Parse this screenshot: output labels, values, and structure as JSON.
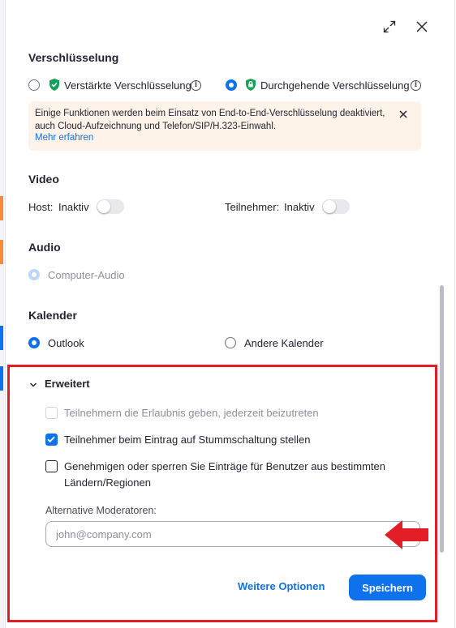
{
  "colors": {
    "accent": "#0e72ed",
    "warning_bg": "#fdf3e9",
    "highlight": "#e31d26",
    "shield_green": "#13a05a"
  },
  "header": {
    "expand_icon": "expand-icon",
    "close_icon": "close-icon"
  },
  "encryption": {
    "title": "Verschlüsselung",
    "enhanced_label": "Verstärkte Verschlüsselung",
    "e2e_label": "Durchgehende Verschlüsselung",
    "selected": "e2e",
    "banner_text": "Einige Funktionen werden beim Einsatz von End-to-End-Verschlüsselung deaktiviert, auch Cloud-Aufzeichnung und Telefon/SIP/H.323-Einwahl.",
    "banner_link": "Mehr erfahren"
  },
  "video": {
    "title": "Video",
    "host_label": "Host:",
    "host_state": "Inaktiv",
    "host_on": false,
    "participant_label": "Teilnehmer:",
    "participant_state": "Inaktiv",
    "participant_on": false
  },
  "audio": {
    "title": "Audio",
    "option": "Computer-Audio"
  },
  "calendar": {
    "title": "Kalender",
    "outlook": "Outlook",
    "other": "Andere Kalender",
    "selected": "outlook"
  },
  "advanced": {
    "title": "Erweitert",
    "join_anytime": "Teilnehmern die Erlaubnis geben, jederzeit beizutreten",
    "join_anytime_checked": false,
    "mute_on_entry": "Teilnehmer beim Eintrag auf Stummschaltung stellen",
    "mute_on_entry_checked": true,
    "region_block_line1": "Genehmigen oder sperren Sie Einträge für Benutzer aus bestimmten",
    "region_block_line2": "Ländern/Regionen",
    "region_block_checked": false,
    "alt_hosts_label": "Alternative Moderatoren:",
    "alt_hosts_placeholder": "john@company.com",
    "alt_hosts_value": ""
  },
  "footer": {
    "more_options": "Weitere Optionen",
    "save": "Speichern"
  }
}
